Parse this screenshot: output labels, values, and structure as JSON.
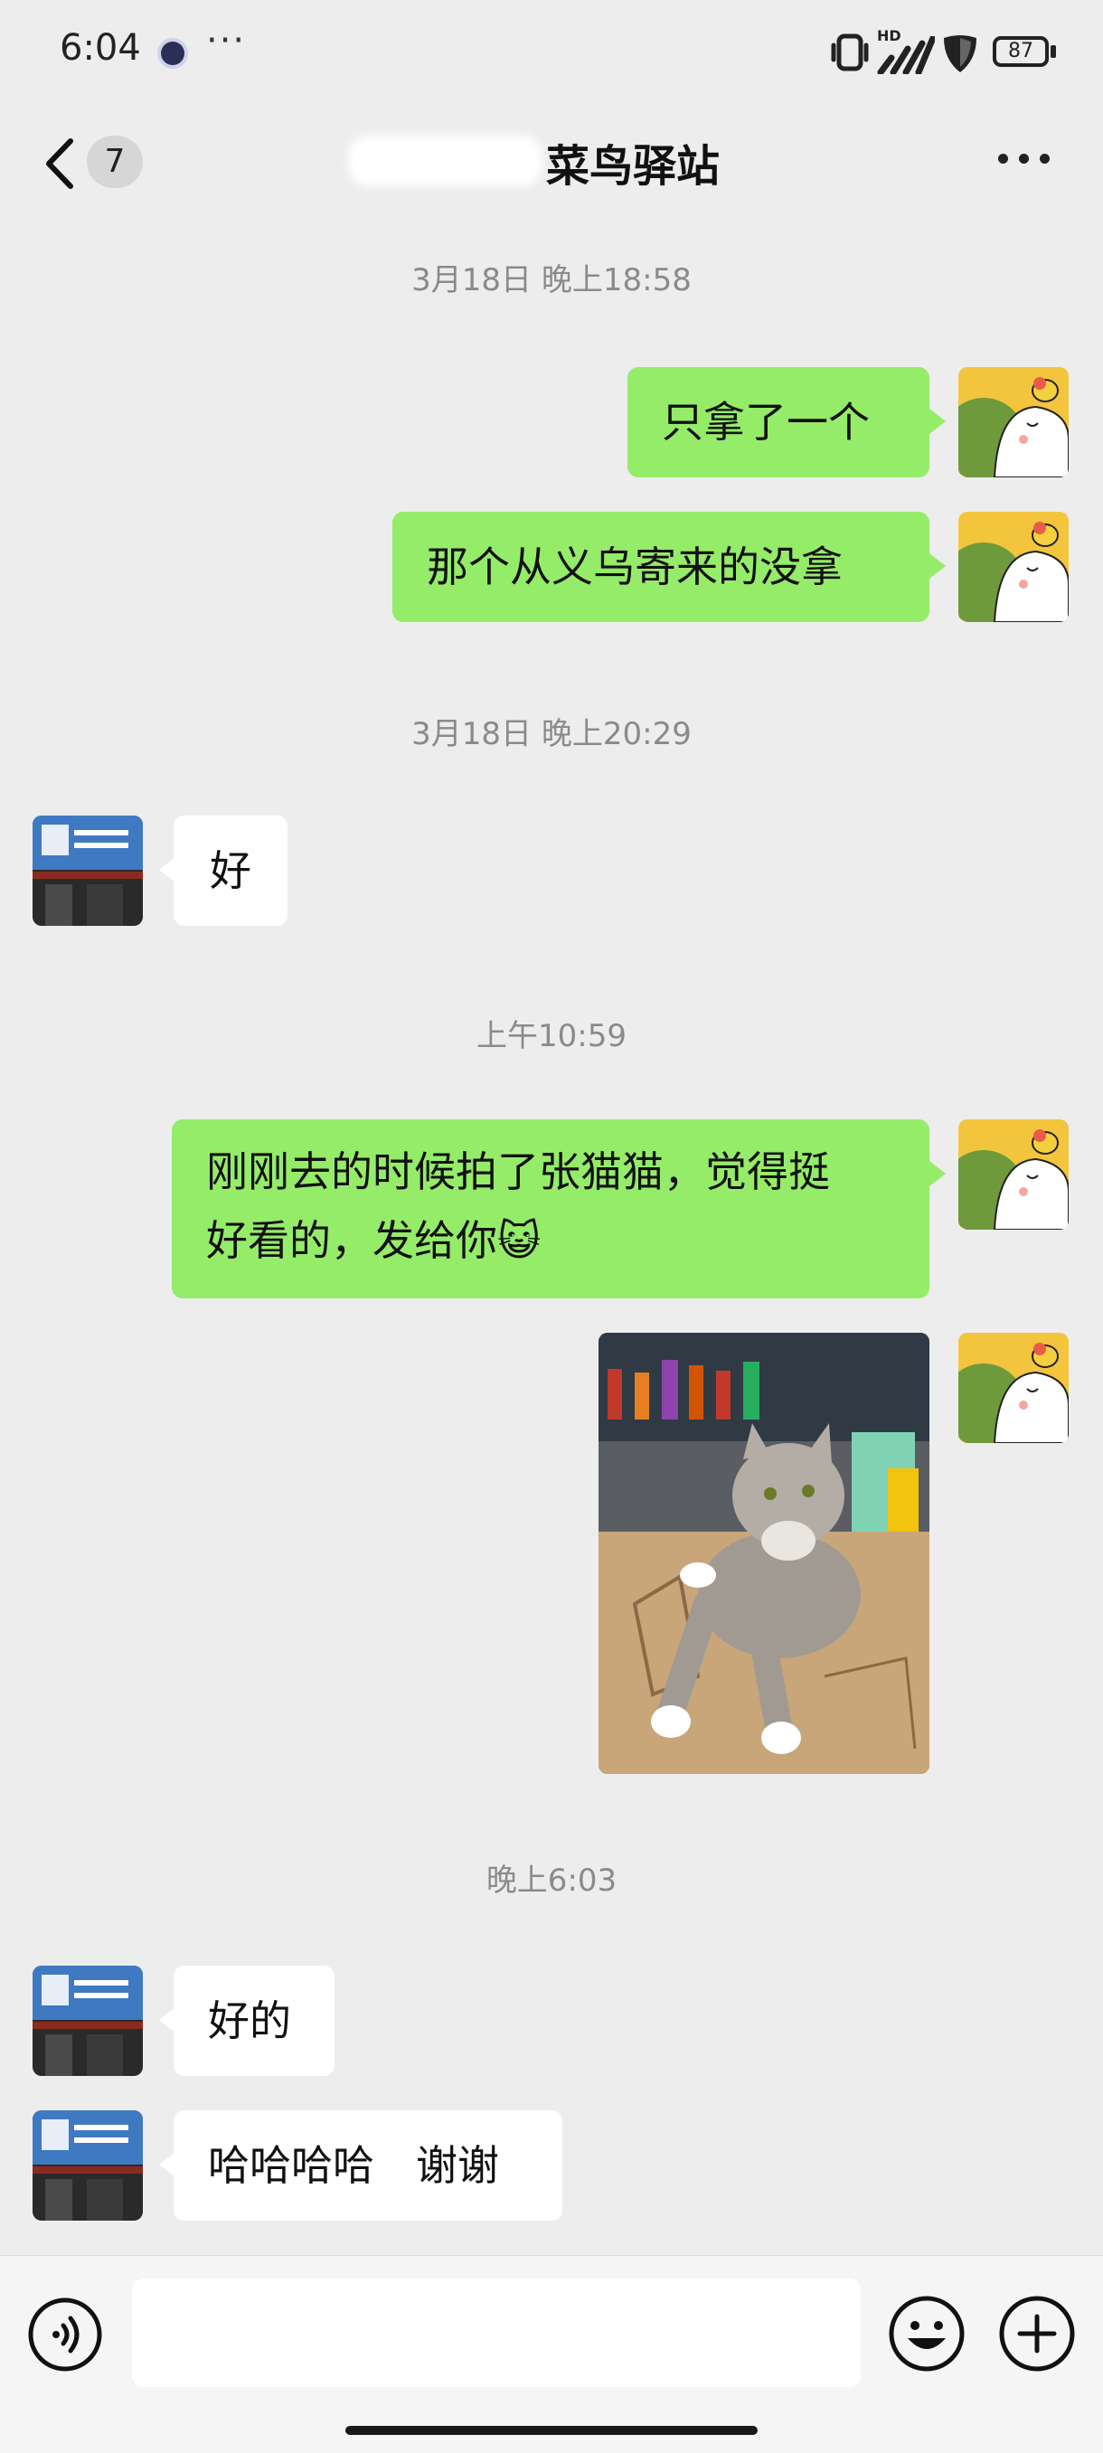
{
  "status_bar": {
    "time": "6:04",
    "more": "···",
    "network": "HD",
    "battery": "87"
  },
  "header": {
    "unread_count": "7",
    "title": "菜鸟驿站"
  },
  "messages": {
    "ts1": "3月18日 晚上18:58",
    "m1": "只拿了一个",
    "m2": "那个从义乌寄来的没拿",
    "ts2": "3月18日 晚上20:29",
    "m3": "好",
    "ts3": "上午10:59",
    "m4_line1": "刚刚去的时候拍了张猫猫，觉得挺",
    "m4_line2": "好看的，发给你",
    "m4_emoji": "😺",
    "ts4": "晚上6:03",
    "m5": "好的",
    "m6": "哈哈哈哈　谢谢"
  },
  "input": {
    "value": ""
  },
  "colors": {
    "outgoing_bubble": "#95ec69",
    "incoming_bubble": "#ffffff",
    "background": "#ededed"
  },
  "icons": [
    "back-icon",
    "more-icon",
    "voice-icon",
    "emoji-icon",
    "add-icon"
  ]
}
